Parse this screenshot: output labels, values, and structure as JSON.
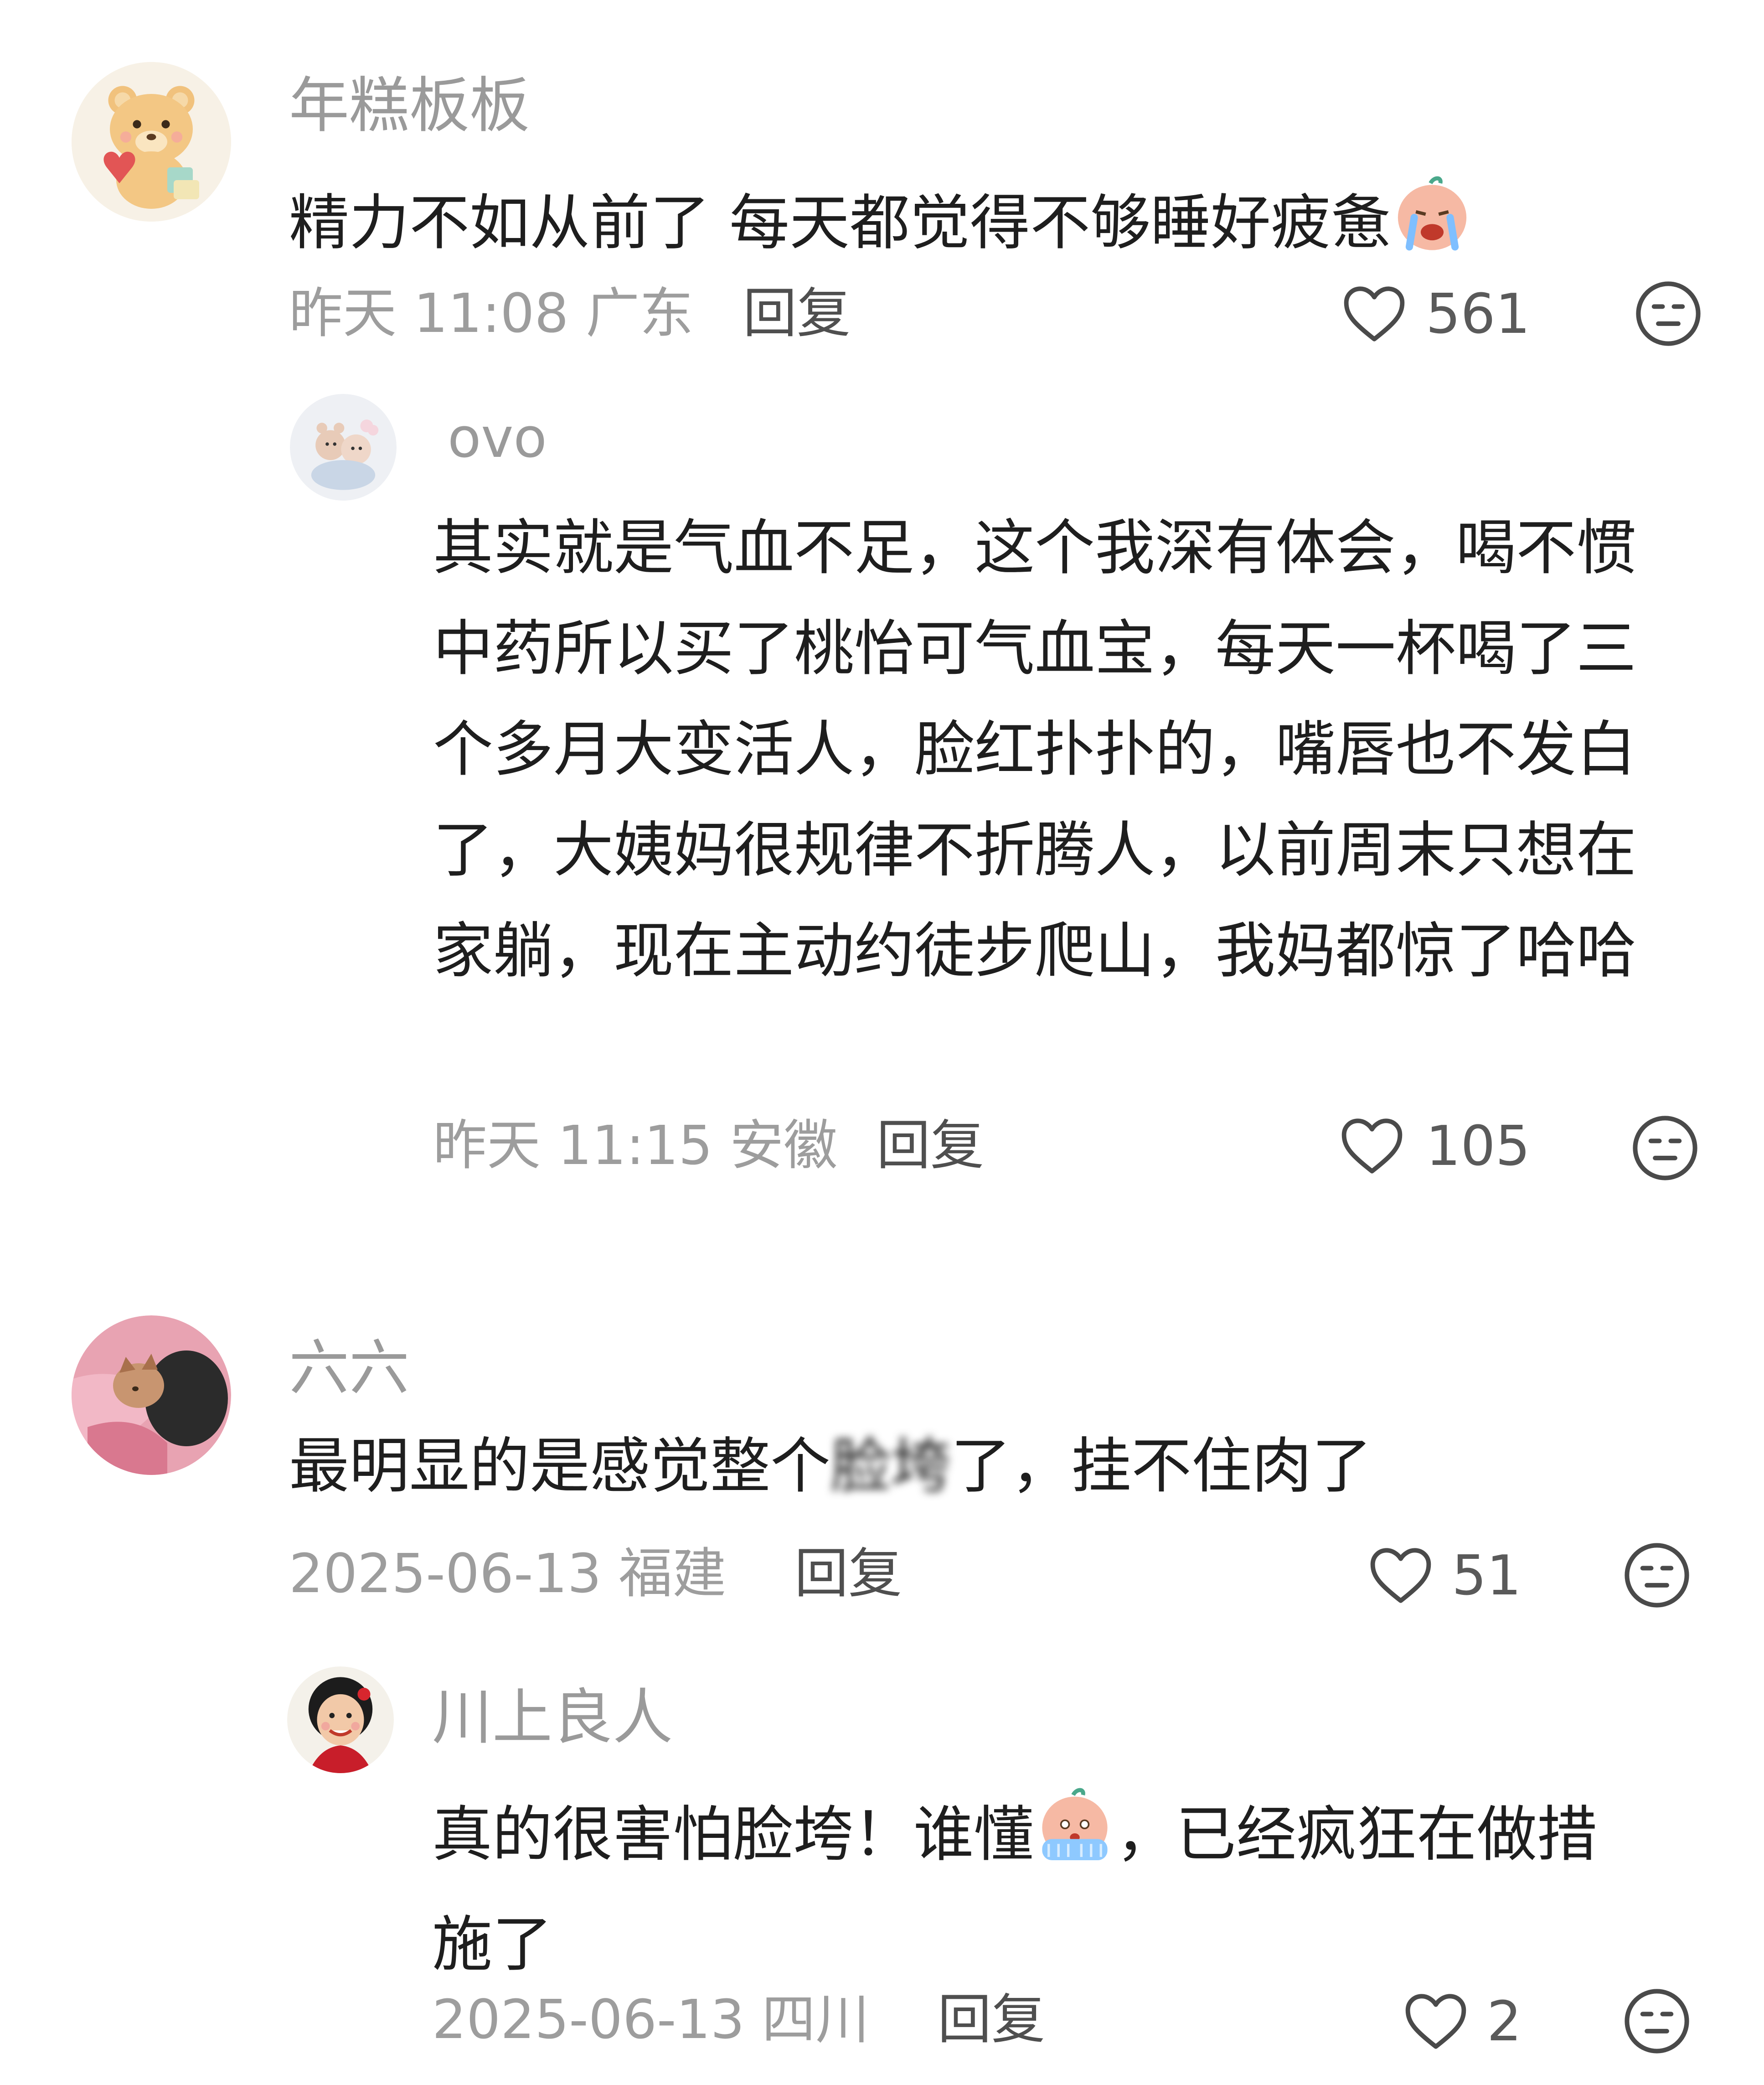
{
  "comments": [
    {
      "user": "年糕板板",
      "text": "精力不如从前了 每天都觉得不够睡好疲惫",
      "emoji": "crying-emoji",
      "time": "昨天 11:08",
      "location": "广东",
      "reply_label": "回复",
      "likes": "561",
      "replies": [
        {
          "user": "ovo",
          "text": "其实就是气血不足，这个我深有体会，喝不惯中药所以买了桃怡可气血宝，每天一杯喝了三个多月大变活人，脸红扑扑的，嘴唇也不发白了，大姨妈很规律不折腾人，以前周末只想在家躺，现在主动约徒步爬山，我妈都惊了哈哈",
          "time": "昨天 11:15",
          "location": "安徽",
          "reply_label": "回复",
          "likes": "105"
        }
      ]
    },
    {
      "user": "六六",
      "text_before": "最明显的是感觉整个",
      "text_hidden": "脸垮",
      "text_after": "了，挂不住肉了",
      "time": "2025-06-13",
      "location": "福建",
      "reply_label": "回复",
      "likes": "51",
      "replies": [
        {
          "user": "川上良人",
          "text_before": "真的很害怕脸垮！谁懂",
          "emoji": "crying-emoji",
          "text_after": "，已经疯狂在做措施了",
          "time": "2025-06-13",
          "location": "四川",
          "reply_label": "回复",
          "likes": "2"
        }
      ]
    }
  ],
  "colors": {
    "name": "#9a9a9a",
    "text": "#1e1e1e",
    "meta": "#9d9d9d",
    "reply": "#4f4f4f",
    "icon": "#4a4a4a"
  }
}
